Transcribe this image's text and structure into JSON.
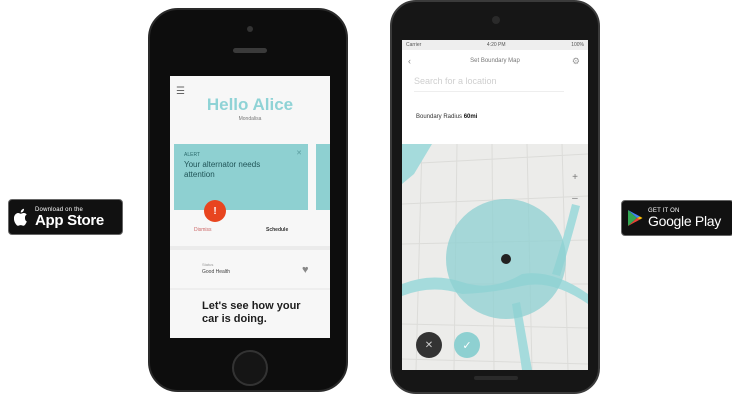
{
  "app_store_badge": {
    "small_text": "Download on the",
    "big_text": "App Store",
    "icon": "apple-icon"
  },
  "google_play_badge": {
    "small_text": "GET IT ON",
    "big_text": "Google Play",
    "icon": "play-triangle-icon"
  },
  "iphone_screen": {
    "menu_icon": "hamburger-icon",
    "greeting": "Hello Alice",
    "subtitle": "Mondalisa",
    "card": {
      "label": "ALERT",
      "message": "Your alternator needs attention",
      "close_icon": "close-icon"
    },
    "alert_badge_icon": "alert-icon",
    "alert_badge_text": "!",
    "action_left": "Dismiss",
    "action_right": "Schedule",
    "status_label": "Status",
    "status_value": "Good Health",
    "heart_icon": "heart-icon",
    "headline": "Let's see how your car is doing."
  },
  "android_screen": {
    "statusbar_left": "Carrier",
    "statusbar_center": "4:20 PM",
    "statusbar_right": "100%",
    "title": "Set Boundary Map",
    "back_icon": "back-arrow-icon",
    "settings_icon": "gear-icon",
    "search_placeholder": "Search for a location",
    "radius_label": "Boundary Radius",
    "radius_value": "60mi",
    "zoom_icons": [
      "plus-icon",
      "minus-icon"
    ],
    "cancel_icon": "close-icon",
    "confirm_icon": "check-icon"
  },
  "colors": {
    "teal": "#8ed0d1",
    "alert_red": "#e8451f",
    "dark": "#0d0d0d"
  }
}
